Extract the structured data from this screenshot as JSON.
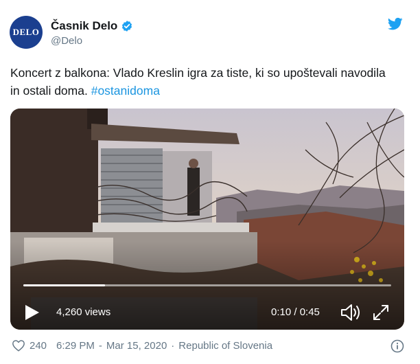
{
  "account": {
    "avatar_text": "DELO",
    "display_name": "Časnik Delo",
    "handle": "@Delo",
    "verified": true
  },
  "tweet": {
    "text_main": "Koncert z balkona: Vlado Kreslin igra za tiste, ki so upoštevali navodila in ostali doma.",
    "hashtag": "#ostanidoma"
  },
  "video": {
    "views": "4,260 views",
    "time": "0:10 / 0:45",
    "progress": 0.222
  },
  "footer": {
    "likes": "240",
    "time": "6:29 PM",
    "date": "Mar 15, 2020",
    "separator": "·",
    "location": "Republic of Slovenia"
  },
  "icons": {
    "verified": "verified-badge-icon",
    "bird": "twitter-bird-icon",
    "play": "play-icon",
    "volume": "volume-icon",
    "fullscreen": "fullscreen-icon",
    "heart": "heart-icon",
    "info": "info-icon"
  },
  "colors": {
    "brand_blue": "#1da1f2",
    "hashtag_blue": "#1b95e0",
    "secondary_text": "#657786",
    "avatar_bg": "#1b3f8f"
  }
}
